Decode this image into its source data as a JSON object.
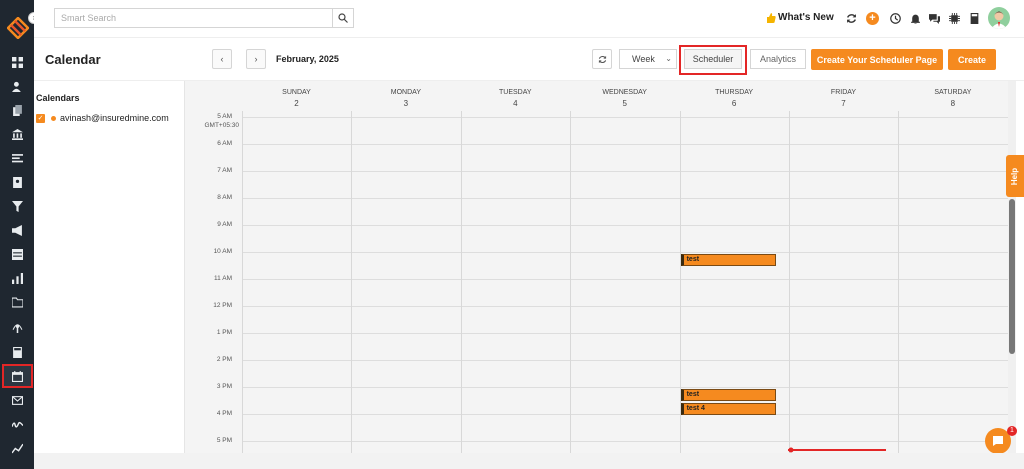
{
  "search": {
    "placeholder": "Smart Search"
  },
  "topbar": {
    "whats_new": "What's New"
  },
  "header": {
    "title": "Calendar",
    "prev": "‹",
    "next": "›",
    "month": "February, 2025",
    "view": "Week",
    "scheduler": "Scheduler",
    "analytics": "Analytics",
    "create_scheduler_page": "Create Your Scheduler Page",
    "create": "Create"
  },
  "calendars": {
    "title": "Calendars",
    "items": [
      {
        "email": "avinash@insuredmine.com",
        "checked": true
      }
    ]
  },
  "days": [
    {
      "name": "SUNDAY",
      "num": "2"
    },
    {
      "name": "MONDAY",
      "num": "3"
    },
    {
      "name": "TUESDAY",
      "num": "4"
    },
    {
      "name": "WEDNESDAY",
      "num": "5"
    },
    {
      "name": "THURSDAY",
      "num": "6"
    },
    {
      "name": "FRIDAY",
      "num": "7"
    },
    {
      "name": "SATURDAY",
      "num": "8"
    }
  ],
  "timezone": "GMT+05:30",
  "times": [
    "5 AM",
    "6 AM",
    "7 AM",
    "8 AM",
    "9 AM",
    "10 AM",
    "11 AM",
    "12 PM",
    "1 PM",
    "2 PM",
    "3 PM",
    "4 PM",
    "5 PM"
  ],
  "events": [
    {
      "title": "test",
      "day": 4,
      "start_hour": 10.0
    },
    {
      "title": "test",
      "day": 4,
      "start_hour": 15.0
    },
    {
      "title": "test 4",
      "day": 4,
      "start_hour": 15.5
    }
  ],
  "help": "Help",
  "chat_badge": "1",
  "colors": {
    "accent": "#f58a1f",
    "rail": "#1f2730",
    "highlight": "#e32626"
  }
}
